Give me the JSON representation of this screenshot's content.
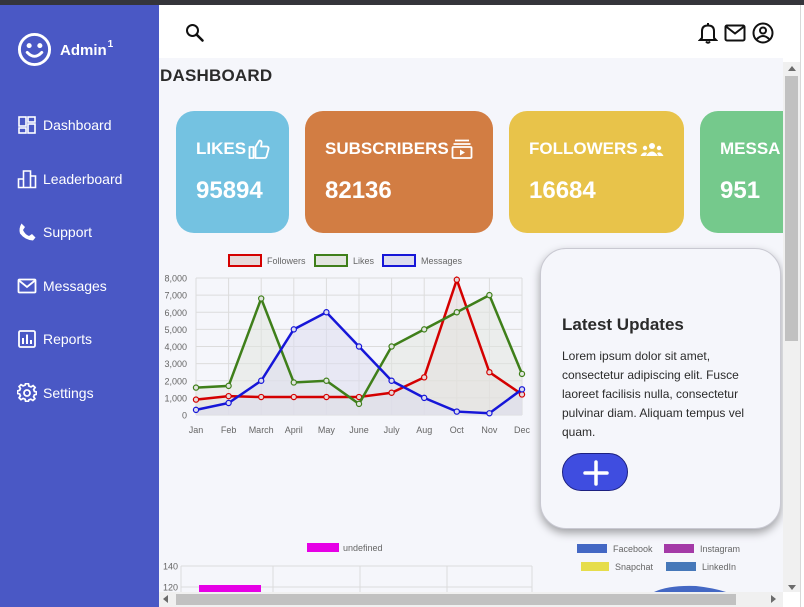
{
  "app": {
    "name": "Admin",
    "name_sup": "1"
  },
  "sidebar": {
    "items": [
      {
        "label": "Dashboard",
        "icon": "dashboard-icon"
      },
      {
        "label": "Leaderboard",
        "icon": "leaderboard-icon"
      },
      {
        "label": "Support",
        "icon": "phone-icon"
      },
      {
        "label": "Messages",
        "icon": "mail-icon"
      },
      {
        "label": "Reports",
        "icon": "bar-chart-icon"
      },
      {
        "label": "Settings",
        "icon": "gear-icon"
      }
    ]
  },
  "topbar": {
    "icons": [
      "search-icon",
      "bell-icon",
      "mail-icon",
      "user-circle-icon"
    ]
  },
  "page": {
    "title": "DASHBOARD"
  },
  "cards": [
    {
      "label": "LIKES",
      "value": "95894",
      "color": "#74c2e1",
      "icon": "thumbs-up-icon"
    },
    {
      "label": "SUBSCRIBERS",
      "value": "82136",
      "color": "#d27d43",
      "icon": "subscriptions-icon"
    },
    {
      "label": "FOLLOWERS",
      "value": "16684",
      "color": "#e8c34a",
      "icon": "people-icon"
    },
    {
      "label": "MESSA",
      "value": "951",
      "color": "#75c98c",
      "icon": ""
    }
  ],
  "updates": {
    "title": "Latest Updates",
    "body": "Lorem ipsum dolor sit amet, consectetur adipiscing elit. Fusce laoreet facilisis nulla, consectetur pulvinar diam. Aliquam tempus vel quam.",
    "button_label": "+"
  },
  "chart_data": [
    {
      "type": "line",
      "x": [
        "Jan",
        "Feb",
        "March",
        "April",
        "May",
        "June",
        "July",
        "Aug",
        "Oct",
        "Nov",
        "Dec"
      ],
      "ylim": [
        0,
        8000
      ],
      "yticks": [
        "0",
        "1,000",
        "2,000",
        "3,000",
        "4,000",
        "5,000",
        "6,000",
        "7,000",
        "8,000"
      ],
      "legend_position": "top",
      "grid": true,
      "series": [
        {
          "name": "Followers",
          "color": "#d40000",
          "fill": "#e6d9d9",
          "values": [
            900,
            1100,
            1050,
            1050,
            1050,
            1050,
            1300,
            2200,
            7900,
            2500,
            1200
          ]
        },
        {
          "name": "Likes",
          "color": "#3f7f1a",
          "fill": "#e2e5e0",
          "values": [
            1600,
            1700,
            6800,
            1900,
            2000,
            650,
            4000,
            5000,
            6000,
            7000,
            2400
          ]
        },
        {
          "name": "Messages",
          "color": "#1616d8",
          "fill": "#dcdcee",
          "values": [
            300,
            700,
            2000,
            5000,
            6000,
            4000,
            2000,
            1000,
            200,
            100,
            1500
          ]
        }
      ]
    },
    {
      "type": "bar",
      "legend_position": "top",
      "series": [
        {
          "name": "undefined",
          "color": "#e600e6"
        }
      ],
      "yticks": [
        "120",
        "140"
      ]
    },
    {
      "type": "pie",
      "legend_position": "top",
      "series": [
        {
          "name": "Facebook",
          "color": "#4468c4"
        },
        {
          "name": "Instagram",
          "color": "#a43aa7"
        },
        {
          "name": "Snapchat",
          "color": "#e6dd4b"
        },
        {
          "name": "LinkedIn",
          "color": "#4678b9"
        }
      ]
    }
  ]
}
